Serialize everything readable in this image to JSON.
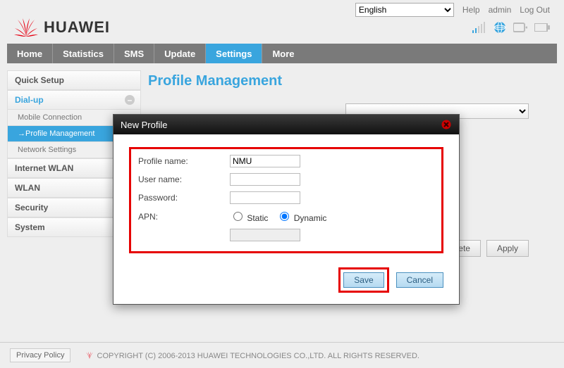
{
  "topbar": {
    "language": "English",
    "help": "Help",
    "admin": "admin",
    "logout": "Log Out"
  },
  "brand": {
    "name": "HUAWEI"
  },
  "nav": {
    "items": [
      "Home",
      "Statistics",
      "SMS",
      "Update",
      "Settings",
      "More"
    ],
    "active_index": 4
  },
  "sidebar": {
    "sections": [
      {
        "label": "Quick Setup"
      },
      {
        "label": "Dial-up",
        "expanded": true,
        "children": [
          {
            "label": "Mobile Connection"
          },
          {
            "label": "Profile Management",
            "active": true,
            "prefix": "→"
          },
          {
            "label": "Network Settings"
          }
        ]
      },
      {
        "label": "Internet WLAN"
      },
      {
        "label": "WLAN"
      },
      {
        "label": "Security"
      },
      {
        "label": "System"
      }
    ]
  },
  "page": {
    "title": "Profile Management",
    "buttons": {
      "delete": "Delete",
      "apply": "Apply"
    }
  },
  "modal": {
    "title": "New Profile",
    "fields": {
      "profile_name_label": "Profile name:",
      "profile_name_value": "NMU",
      "user_name_label": "User name:",
      "user_name_value": "",
      "password_label": "Password:",
      "password_value": "",
      "apn_label": "APN:",
      "apn_static": "Static",
      "apn_dynamic": "Dynamic",
      "apn_selected": "dynamic",
      "apn_value": ""
    },
    "buttons": {
      "save": "Save",
      "cancel": "Cancel"
    }
  },
  "footer": {
    "privacy": "Privacy Policy",
    "copyright": "COPYRIGHT (C) 2006-2013 HUAWEI TECHNOLOGIES CO.,LTD. ALL RIGHTS RESERVED."
  }
}
